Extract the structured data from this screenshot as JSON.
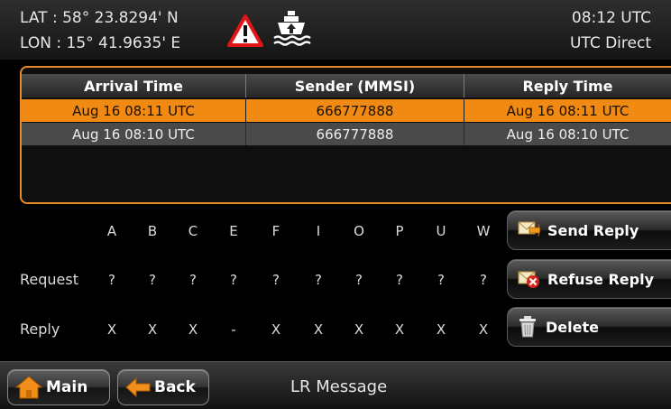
{
  "header": {
    "lat": "LAT : 58° 23.8294' N",
    "lon": "LON : 15° 41.9635' E",
    "time": "08:12 UTC",
    "time_source": "UTC Direct",
    "icons": [
      "warning-triangle-icon",
      "ship-icon"
    ]
  },
  "table": {
    "columns": [
      "Arrival Time",
      "Sender (MMSI)",
      "Reply Time"
    ],
    "rows": [
      {
        "arrival": "Aug 16 08:11 UTC",
        "sender": "666777888",
        "reply": "Aug 16 08:11 UTC",
        "selected": true
      },
      {
        "arrival": "Aug 16 08:10 UTC",
        "sender": "666777888",
        "reply": "Aug 16 08:10 UTC",
        "selected": false
      }
    ]
  },
  "grid": {
    "letters": [
      "A",
      "B",
      "C",
      "E",
      "F",
      "I",
      "O",
      "P",
      "U",
      "W"
    ],
    "request_label": "Request",
    "request": [
      "?",
      "?",
      "?",
      "?",
      "?",
      "?",
      "?",
      "?",
      "?",
      "?"
    ],
    "reply_label": "Reply",
    "reply": [
      "X",
      "X",
      "X",
      "-",
      "X",
      "X",
      "X",
      "X",
      "X",
      "X"
    ]
  },
  "actions": {
    "send_reply": "Send Reply",
    "refuse_reply": "Refuse Reply",
    "delete": "Delete"
  },
  "nav": {
    "main": "Main",
    "back": "Back",
    "screen_title": "LR Message"
  },
  "colors": {
    "accent": "#f08a12",
    "frame": "#e88a2c",
    "warning": "#e01515"
  }
}
